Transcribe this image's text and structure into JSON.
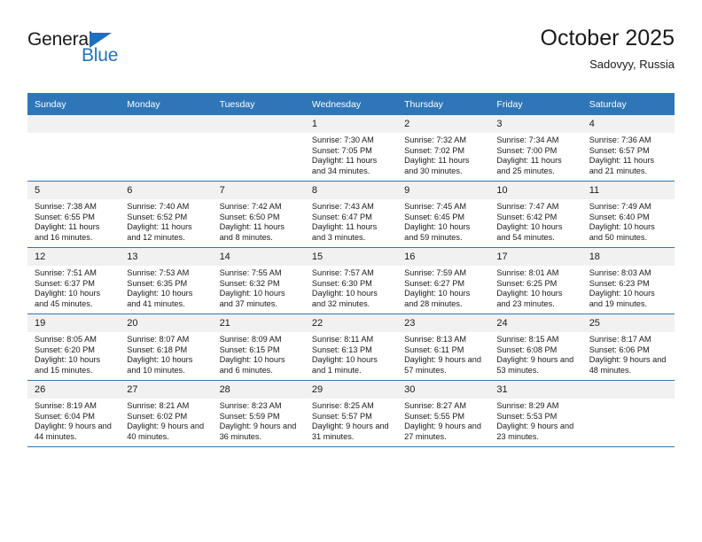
{
  "brand": {
    "name_top": "General",
    "name_bottom": "Blue",
    "triangle_color": "#1f6fc0",
    "text_color": "#1f74c4"
  },
  "header": {
    "title": "October 2025",
    "subtitle": "Sadovyy, Russia"
  },
  "theme": {
    "header_blue": "#2f76b8",
    "daynum_gray": "#f1f1f1",
    "text_black": "#1a1a1a"
  },
  "weekdays": [
    "Sunday",
    "Monday",
    "Tuesday",
    "Wednesday",
    "Thursday",
    "Friday",
    "Saturday"
  ],
  "weeks": [
    [
      {
        "day": "",
        "empty": true
      },
      {
        "day": "",
        "empty": true
      },
      {
        "day": "",
        "empty": true
      },
      {
        "day": "1",
        "sunrise": "Sunrise: 7:30 AM",
        "sunset": "Sunset: 7:05 PM",
        "daylight": "Daylight: 11 hours and 34 minutes."
      },
      {
        "day": "2",
        "sunrise": "Sunrise: 7:32 AM",
        "sunset": "Sunset: 7:02 PM",
        "daylight": "Daylight: 11 hours and 30 minutes."
      },
      {
        "day": "3",
        "sunrise": "Sunrise: 7:34 AM",
        "sunset": "Sunset: 7:00 PM",
        "daylight": "Daylight: 11 hours and 25 minutes."
      },
      {
        "day": "4",
        "sunrise": "Sunrise: 7:36 AM",
        "sunset": "Sunset: 6:57 PM",
        "daylight": "Daylight: 11 hours and 21 minutes."
      }
    ],
    [
      {
        "day": "5",
        "sunrise": "Sunrise: 7:38 AM",
        "sunset": "Sunset: 6:55 PM",
        "daylight": "Daylight: 11 hours and 16 minutes."
      },
      {
        "day": "6",
        "sunrise": "Sunrise: 7:40 AM",
        "sunset": "Sunset: 6:52 PM",
        "daylight": "Daylight: 11 hours and 12 minutes."
      },
      {
        "day": "7",
        "sunrise": "Sunrise: 7:42 AM",
        "sunset": "Sunset: 6:50 PM",
        "daylight": "Daylight: 11 hours and 8 minutes."
      },
      {
        "day": "8",
        "sunrise": "Sunrise: 7:43 AM",
        "sunset": "Sunset: 6:47 PM",
        "daylight": "Daylight: 11 hours and 3 minutes."
      },
      {
        "day": "9",
        "sunrise": "Sunrise: 7:45 AM",
        "sunset": "Sunset: 6:45 PM",
        "daylight": "Daylight: 10 hours and 59 minutes."
      },
      {
        "day": "10",
        "sunrise": "Sunrise: 7:47 AM",
        "sunset": "Sunset: 6:42 PM",
        "daylight": "Daylight: 10 hours and 54 minutes."
      },
      {
        "day": "11",
        "sunrise": "Sunrise: 7:49 AM",
        "sunset": "Sunset: 6:40 PM",
        "daylight": "Daylight: 10 hours and 50 minutes."
      }
    ],
    [
      {
        "day": "12",
        "sunrise": "Sunrise: 7:51 AM",
        "sunset": "Sunset: 6:37 PM",
        "daylight": "Daylight: 10 hours and 45 minutes."
      },
      {
        "day": "13",
        "sunrise": "Sunrise: 7:53 AM",
        "sunset": "Sunset: 6:35 PM",
        "daylight": "Daylight: 10 hours and 41 minutes."
      },
      {
        "day": "14",
        "sunrise": "Sunrise: 7:55 AM",
        "sunset": "Sunset: 6:32 PM",
        "daylight": "Daylight: 10 hours and 37 minutes."
      },
      {
        "day": "15",
        "sunrise": "Sunrise: 7:57 AM",
        "sunset": "Sunset: 6:30 PM",
        "daylight": "Daylight: 10 hours and 32 minutes."
      },
      {
        "day": "16",
        "sunrise": "Sunrise: 7:59 AM",
        "sunset": "Sunset: 6:27 PM",
        "daylight": "Daylight: 10 hours and 28 minutes."
      },
      {
        "day": "17",
        "sunrise": "Sunrise: 8:01 AM",
        "sunset": "Sunset: 6:25 PM",
        "daylight": "Daylight: 10 hours and 23 minutes."
      },
      {
        "day": "18",
        "sunrise": "Sunrise: 8:03 AM",
        "sunset": "Sunset: 6:23 PM",
        "daylight": "Daylight: 10 hours and 19 minutes."
      }
    ],
    [
      {
        "day": "19",
        "sunrise": "Sunrise: 8:05 AM",
        "sunset": "Sunset: 6:20 PM",
        "daylight": "Daylight: 10 hours and 15 minutes."
      },
      {
        "day": "20",
        "sunrise": "Sunrise: 8:07 AM",
        "sunset": "Sunset: 6:18 PM",
        "daylight": "Daylight: 10 hours and 10 minutes."
      },
      {
        "day": "21",
        "sunrise": "Sunrise: 8:09 AM",
        "sunset": "Sunset: 6:15 PM",
        "daylight": "Daylight: 10 hours and 6 minutes."
      },
      {
        "day": "22",
        "sunrise": "Sunrise: 8:11 AM",
        "sunset": "Sunset: 6:13 PM",
        "daylight": "Daylight: 10 hours and 1 minute."
      },
      {
        "day": "23",
        "sunrise": "Sunrise: 8:13 AM",
        "sunset": "Sunset: 6:11 PM",
        "daylight": "Daylight: 9 hours and 57 minutes."
      },
      {
        "day": "24",
        "sunrise": "Sunrise: 8:15 AM",
        "sunset": "Sunset: 6:08 PM",
        "daylight": "Daylight: 9 hours and 53 minutes."
      },
      {
        "day": "25",
        "sunrise": "Sunrise: 8:17 AM",
        "sunset": "Sunset: 6:06 PM",
        "daylight": "Daylight: 9 hours and 48 minutes."
      }
    ],
    [
      {
        "day": "26",
        "sunrise": "Sunrise: 8:19 AM",
        "sunset": "Sunset: 6:04 PM",
        "daylight": "Daylight: 9 hours and 44 minutes."
      },
      {
        "day": "27",
        "sunrise": "Sunrise: 8:21 AM",
        "sunset": "Sunset: 6:02 PM",
        "daylight": "Daylight: 9 hours and 40 minutes."
      },
      {
        "day": "28",
        "sunrise": "Sunrise: 8:23 AM",
        "sunset": "Sunset: 5:59 PM",
        "daylight": "Daylight: 9 hours and 36 minutes."
      },
      {
        "day": "29",
        "sunrise": "Sunrise: 8:25 AM",
        "sunset": "Sunset: 5:57 PM",
        "daylight": "Daylight: 9 hours and 31 minutes."
      },
      {
        "day": "30",
        "sunrise": "Sunrise: 8:27 AM",
        "sunset": "Sunset: 5:55 PM",
        "daylight": "Daylight: 9 hours and 27 minutes."
      },
      {
        "day": "31",
        "sunrise": "Sunrise: 8:29 AM",
        "sunset": "Sunset: 5:53 PM",
        "daylight": "Daylight: 9 hours and 23 minutes."
      },
      {
        "day": "",
        "empty": true
      }
    ]
  ]
}
